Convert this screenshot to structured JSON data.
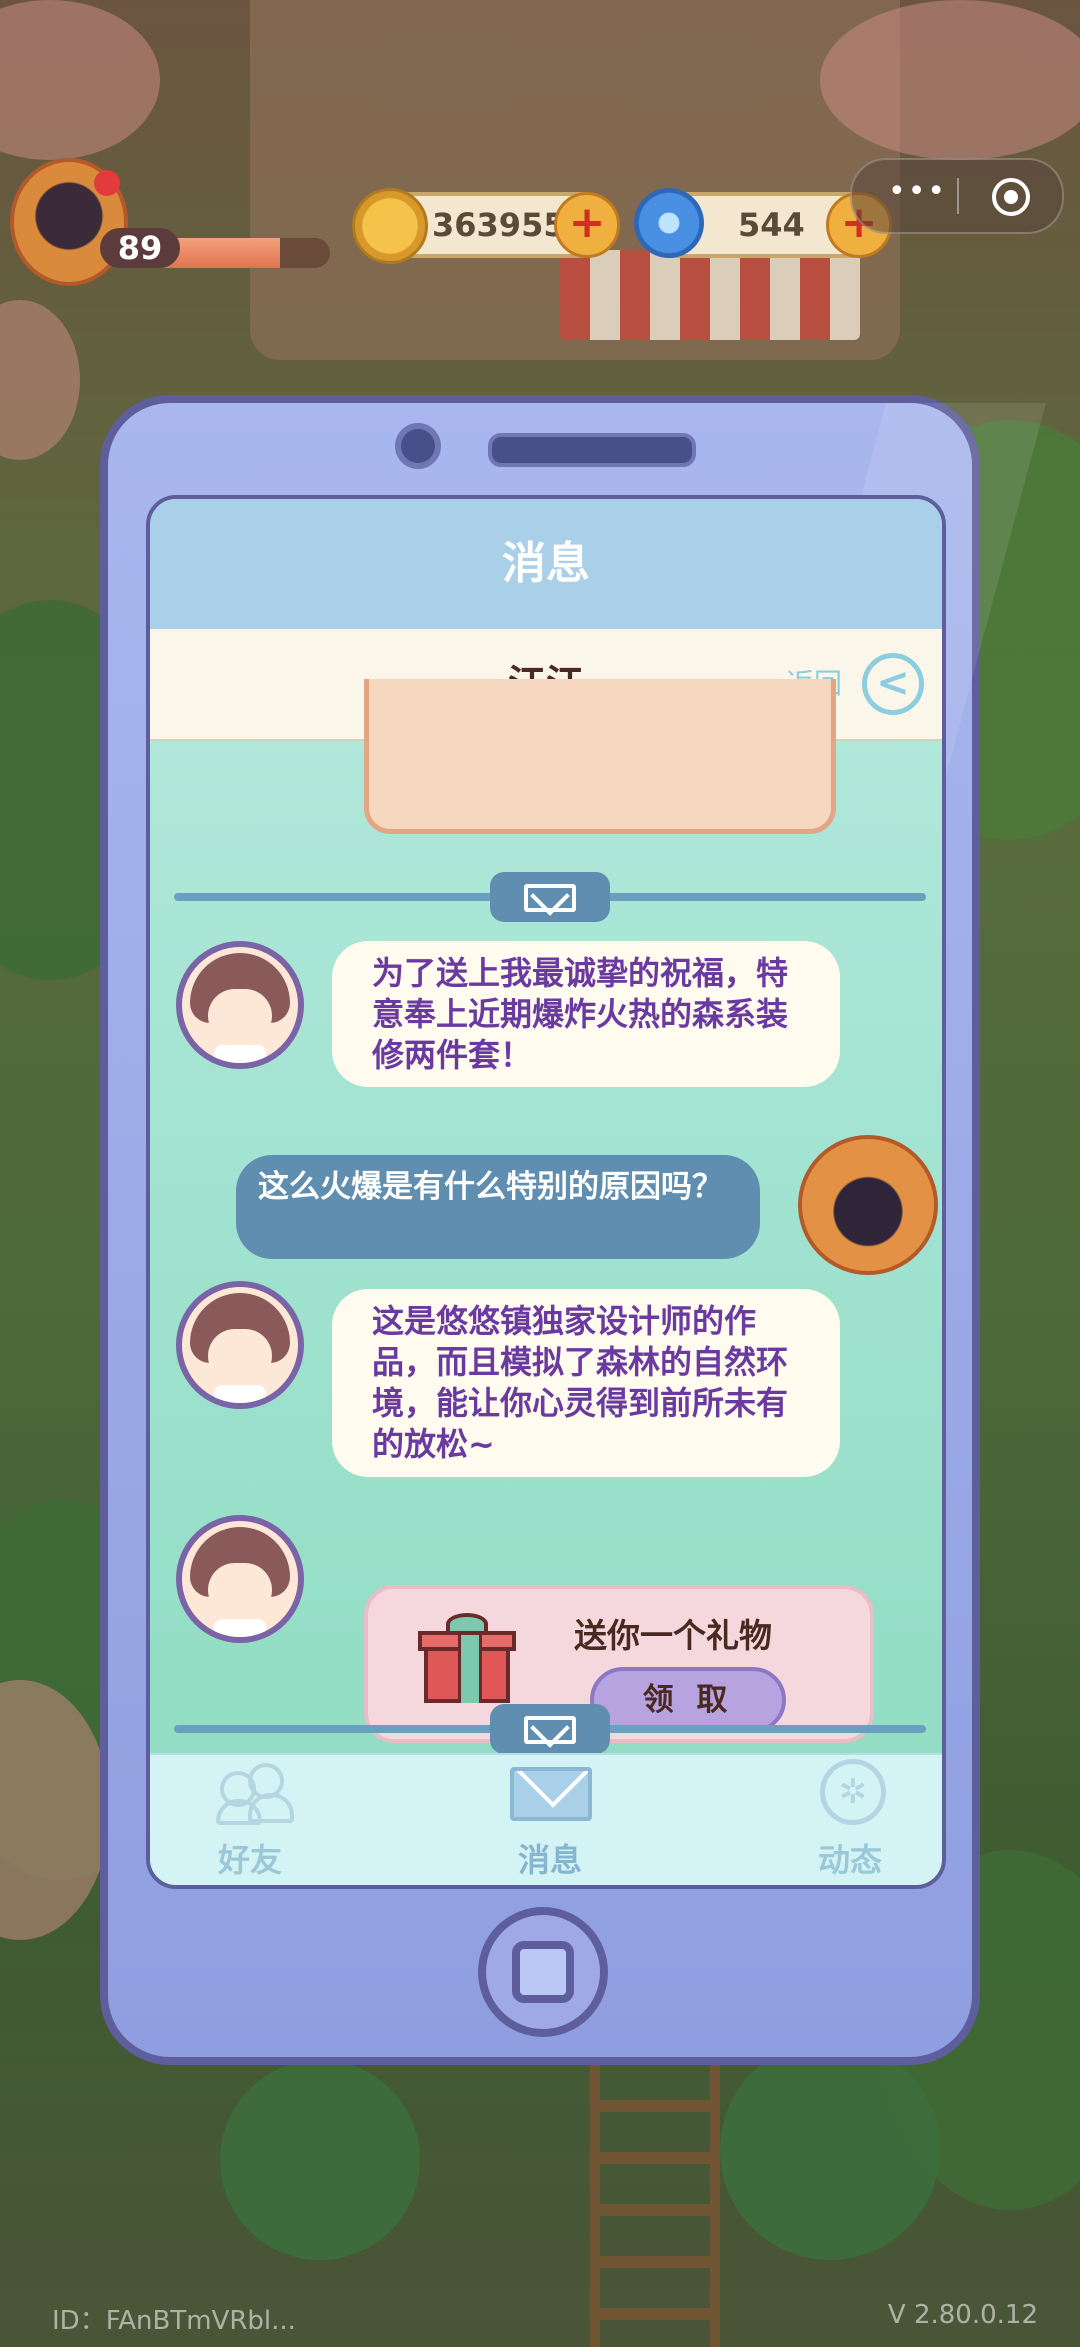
{
  "hud": {
    "level": "89",
    "hp_fraction": 0.72,
    "leaves": "363955",
    "gems": "544",
    "plus_glyph": "+",
    "more_glyph": "•••"
  },
  "phone": {
    "title": "消息",
    "chat_partner": "江江",
    "back_label": "返回",
    "back_glyph": "<",
    "messages": [
      {
        "from": "friend",
        "text": "为了送上我最诚挚的祝福，特意奉上近期爆炸火热的森系装修两件套！"
      },
      {
        "from": "self",
        "text": "这么火爆是有什么特别的原因吗？"
      },
      {
        "from": "friend",
        "text": "这是悠悠镇独家设计师的作品，而且模拟了森林的自然环境，能让你心灵得到前所未有的放松~"
      }
    ],
    "gift": {
      "title": "送你一个礼物",
      "button": "领 取"
    },
    "tabs": [
      {
        "label": "好友",
        "icon": "friends-icon"
      },
      {
        "label": "消息",
        "icon": "mail-icon"
      },
      {
        "label": "动态",
        "icon": "feed-icon"
      }
    ]
  },
  "footer": {
    "id": "ID：FAnBTmVRbl...",
    "version": "V 2.80.0.12"
  },
  "colors": {
    "bubble_text": "#6a3aa0",
    "self_bubble": "#5f8eb0",
    "accent_title": "#a9cfe9"
  }
}
